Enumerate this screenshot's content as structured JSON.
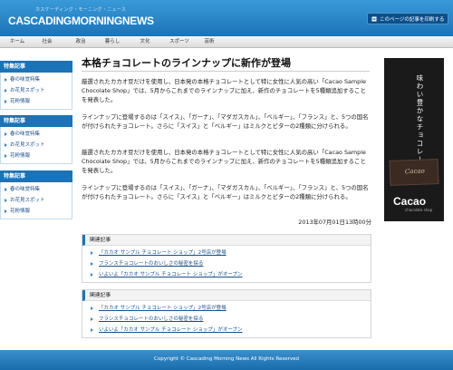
{
  "header": {
    "logo_tagline": "カスケーディング・モーニング・ニュース",
    "logo_part1": "CASCADING",
    "logo_part2": "MORNING",
    "logo_part3": "NEWS",
    "bookmark_label": "このページの記事を印刷する"
  },
  "nav": {
    "items": [
      {
        "label": "ホーム"
      },
      {
        "label": "社会"
      },
      {
        "label": "政治"
      },
      {
        "label": "暮らし"
      },
      {
        "label": "文化"
      },
      {
        "label": "スポーツ"
      },
      {
        "label": "芸術"
      }
    ]
  },
  "sidebar": {
    "sections": [
      {
        "heading": "特集記事",
        "items": [
          {
            "label": "春の味覚特集"
          },
          {
            "label": "お花見スポット"
          },
          {
            "label": "花粉情報"
          }
        ]
      },
      {
        "heading": "特集記事",
        "items": [
          {
            "label": "春の味覚特集"
          },
          {
            "label": "お花見スポット"
          },
          {
            "label": "花粉情報"
          }
        ]
      },
      {
        "heading": "特集記事",
        "items": [
          {
            "label": "春の味覚特集"
          },
          {
            "label": "お花見スポット"
          },
          {
            "label": "花粉情報"
          }
        ]
      }
    ]
  },
  "article": {
    "title": "本格チョコレートのラインナップに新作が登場",
    "paragraphs": [
      "厳選されたカカオ豆だけを使用し、日本発の本格チョコレートとして特に女性に人気の高い「Cacao Sample Chocolate Shop」では、5月からこれまでのラインナップに加え、新作のチョコレートを5種類追加することを発表した。",
      "ラインナップに登場するのは「スイス」、「ガーナ」、「マダガスカル」、「ベルギー」、「フランス」と、5つの国名が付けられたチョコレート。さらに「スイス」と「ベルギー」はミルクとビターの2種類に分けられる。",
      "厳選されたカカオ豆だけを使用し、日本発の本格チョコレートとして特に女性に人気の高い「Cacao Sample Chocolate Shop」では、5月からこれまでのラインナップに加え、新作のチョコレートを5種類追加することを発表した。",
      "ラインナップに登場するのは「スイス」、「ガーナ」、「マダガスカル」、「ベルギー」、「フランス」と、5つの国名が付けられたチョコレート。さらに「スイス」と「ベルギー」はミルクとビターの2種類に分けられる。"
    ],
    "date": "2013年07月01日13時00分"
  },
  "related": [
    {
      "heading": "関連記事",
      "items": [
        {
          "label": "「カカオ サンプル チョコレート ショップ」2号店が登場"
        },
        {
          "label": "フランスチョコレートのおいしさの秘密を探る"
        },
        {
          "label": "いよいよ「カカオ サンプル チョコレート ショップ」がオープン"
        }
      ]
    },
    {
      "heading": "関連記事",
      "items": [
        {
          "label": "「カカオ サンプル チョコレート ショップ」2号店が登場"
        },
        {
          "label": "フランスチョコレートのおいしさの秘密を探る"
        },
        {
          "label": "いよいよ「カカオ サンプル チョコレート ショップ」がオープン"
        }
      ]
    }
  ],
  "ad": {
    "copy": "味わい豊かなチョコレート。",
    "card_text": "Cacao",
    "brand": "Cacao",
    "brand_sub": "chocolate shop"
  },
  "footer": {
    "copyright": "Copyright © Cascading Morning News All Rights Reserved"
  },
  "colors": {
    "brand_blue": "#1b73b8",
    "link": "#1a4f8a"
  }
}
